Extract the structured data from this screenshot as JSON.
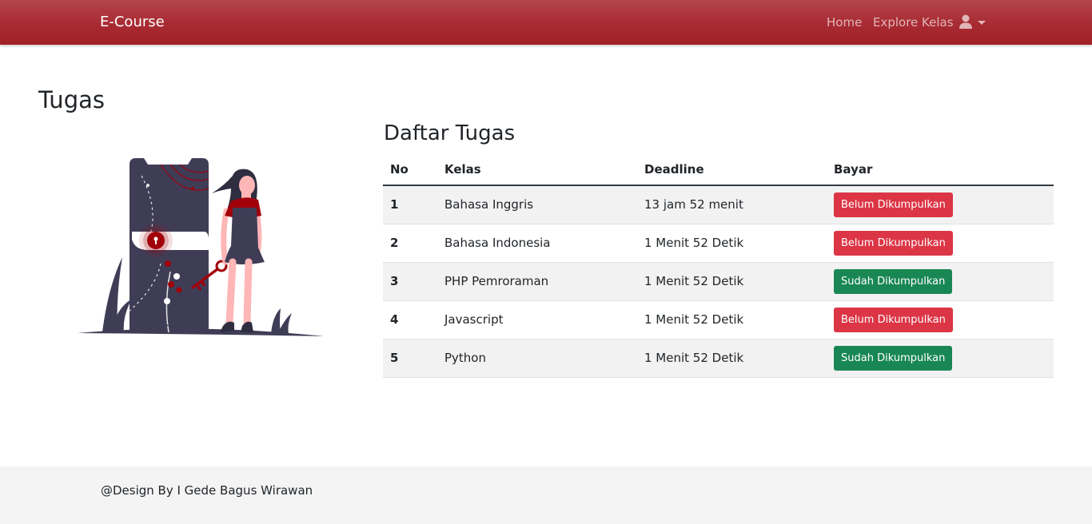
{
  "navbar": {
    "brand": "E-Course",
    "links": [
      {
        "label": "Home"
      },
      {
        "label": "Explore Kelas"
      }
    ],
    "user_icon": "user-icon",
    "color": "#a82a32"
  },
  "page": {
    "title": "Tugas",
    "section_title": "Daftar Tugas"
  },
  "table": {
    "headers": [
      "No",
      "Kelas",
      "Deadline",
      "Bayar"
    ],
    "rows": [
      {
        "no": "1",
        "kelas": "Bahasa Inggris",
        "deadline": "13 jam 52 menit",
        "status": "Belum Dikumpulkan",
        "status_type": "danger"
      },
      {
        "no": "2",
        "kelas": "Bahasa Indonesia",
        "deadline": "1 Menit 52 Detik",
        "status": "Belum Dikumpulkan",
        "status_type": "danger"
      },
      {
        "no": "3",
        "kelas": "PHP Pemroraman",
        "deadline": "1 Menit 52 Detik",
        "status": "Sudah Dikumpulkan",
        "status_type": "success"
      },
      {
        "no": "4",
        "kelas": "Javascript",
        "deadline": "1 Menit 52 Detik",
        "status": "Belum Dikumpulkan",
        "status_type": "danger"
      },
      {
        "no": "5",
        "kelas": "Python",
        "deadline": "1 Menit 52 Detik",
        "status": "Sudah Dikumpulkan",
        "status_type": "success"
      }
    ]
  },
  "colors": {
    "danger": "#dc3545",
    "success": "#198754",
    "accent": "#a12127"
  },
  "footer": {
    "text": "@Design By I Gede Bagus Wirawan"
  }
}
